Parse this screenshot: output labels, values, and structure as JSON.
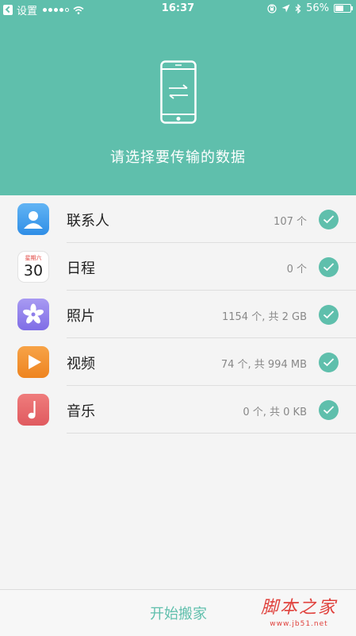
{
  "status_bar": {
    "back_label": "设置",
    "time": "16:37",
    "battery": "56%",
    "battery_level": 0.56
  },
  "header": {
    "title": "请选择要传输的数据",
    "background_color": "#5fbfac"
  },
  "items": [
    {
      "label": "联系人",
      "value": "107 个",
      "icon": "contacts-icon",
      "checked": true
    },
    {
      "label": "日程",
      "value": "0 个",
      "icon": "calendar-icon",
      "icon_weekday": "星期六",
      "icon_day": "30",
      "checked": true
    },
    {
      "label": "照片",
      "value": "1154 个, 共 2 GB",
      "icon": "photos-icon",
      "checked": true
    },
    {
      "label": "视频",
      "value": "74 个, 共 994 MB",
      "icon": "video-icon",
      "checked": true
    },
    {
      "label": "音乐",
      "value": "0 个, 共 0 KB",
      "icon": "music-icon",
      "checked": true
    }
  ],
  "bottom": {
    "start_label": "开始搬家"
  },
  "watermark": {
    "main": "脚本之家",
    "sub": "www.jb51.net"
  },
  "colors": {
    "accent": "#5fbfac",
    "watermark": "#e0413c"
  }
}
